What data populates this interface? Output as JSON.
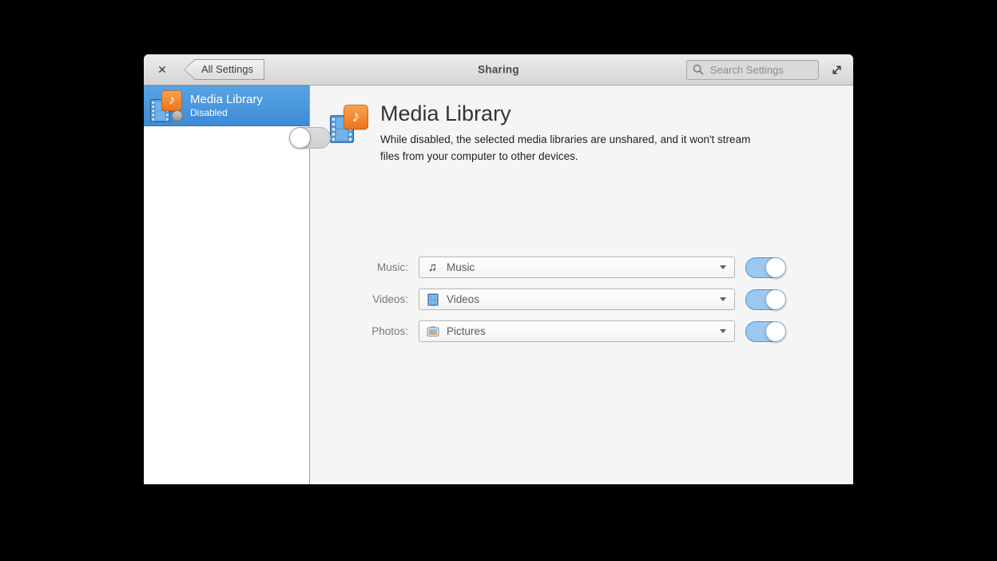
{
  "titlebar": {
    "close_glyph": "✕",
    "back_label": "All Settings",
    "title": "Sharing",
    "search_placeholder": "Search Settings"
  },
  "sidebar": {
    "items": [
      {
        "title": "Media Library",
        "status": "Disabled",
        "selected": true
      }
    ]
  },
  "content": {
    "title": "Media Library",
    "description": "While disabled, the selected media libraries are unshared, and it won't stream files from your computer to other devices.",
    "master_toggle_state": "off",
    "rows": [
      {
        "label": "Music:",
        "value": "Music",
        "icon": "music-note-icon",
        "toggle_state": "on"
      },
      {
        "label": "Videos:",
        "value": "Videos",
        "icon": "film-strip-icon",
        "toggle_state": "on"
      },
      {
        "label": "Photos:",
        "value": "Pictures",
        "icon": "photo-icon",
        "toggle_state": "on"
      }
    ]
  },
  "icons": {
    "note_glyph": "♪",
    "music_combo_glyph": "♫"
  },
  "colors": {
    "accent_blue": "#4a94d9",
    "selection_gradient_top": "#58a3e2",
    "selection_gradient_bottom": "#3c8bd8",
    "toggle_on_track": "#9cc7ee",
    "icon_orange": "#ec7420",
    "icon_film_blue": "#4d97dd"
  }
}
